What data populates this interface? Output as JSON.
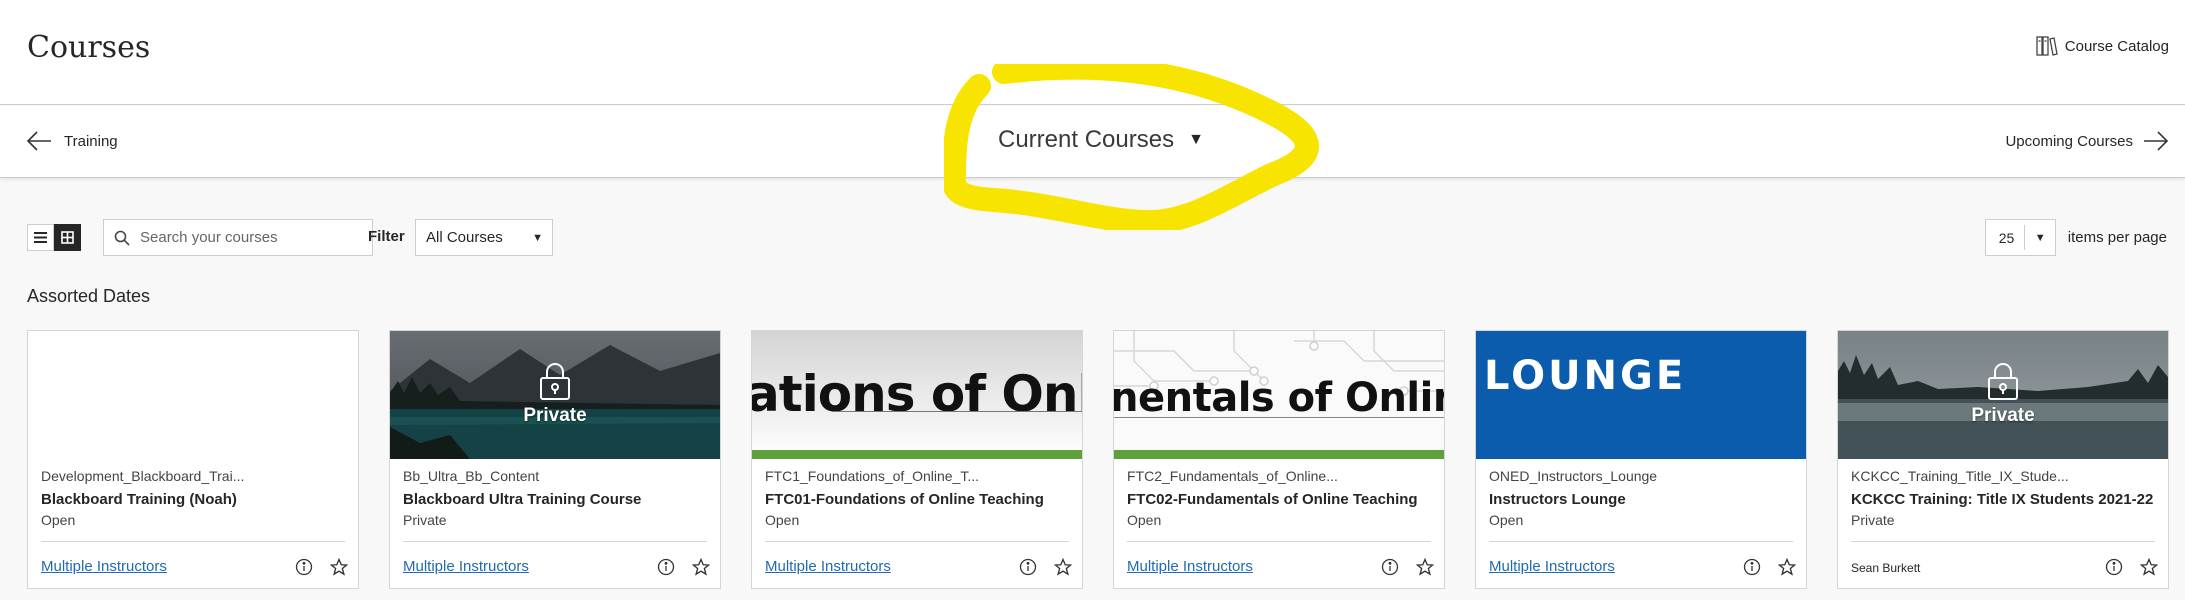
{
  "header": {
    "title": "Courses",
    "catalog_label": "Course Catalog"
  },
  "term_nav": {
    "previous": "Training",
    "current": "Current Courses",
    "next": "Upcoming Courses"
  },
  "toolbar": {
    "search_placeholder": "Search your courses",
    "filter_label": "Filter",
    "filter_value": "All Courses",
    "per_page_value": "25",
    "per_page_label": "items per page"
  },
  "section": {
    "title": "Assorted Dates"
  },
  "courses": [
    {
      "id": "Development_Blackboard_Trai...",
      "name": "Blackboard Training (Noah)",
      "status": "Open",
      "instructor": "Multiple Instructors",
      "banner": "blank"
    },
    {
      "id": "Bb_Ultra_Bb_Content",
      "name": "Blackboard Ultra Training Course",
      "status": "Private",
      "instructor": "Multiple Instructors",
      "banner": "private-lake",
      "overlay_label": "Private"
    },
    {
      "id": "FTC1_Foundations_of_Online_T...",
      "name": "FTC01-Foundations of Online Teaching",
      "status": "Open",
      "instructor": "Multiple Instructors",
      "banner": "foundations",
      "banner_text": "ations of Onlin"
    },
    {
      "id": "FTC2_Fundamentals_of_Online...",
      "name": "FTC02-Fundamentals of Online Teaching",
      "status": "Open",
      "instructor": "Multiple Instructors",
      "banner": "fundamentals",
      "banner_text": "nentals of Online"
    },
    {
      "id": "ONED_Instructors_Lounge",
      "name": "Instructors Lounge",
      "status": "Open",
      "instructor": "Multiple Instructors",
      "banner": "lounge",
      "banner_text": "LOUNGE"
    },
    {
      "id": "KCKCC_Training_Title_IX_Stude...",
      "name": "KCKCC Training: Title IX Students 2021-22",
      "status": "Private",
      "instructor": "Sean Burkett",
      "banner": "private-fog",
      "overlay_label": "Private"
    }
  ],
  "colors": {
    "link": "#1f6ab5",
    "highlight": "#f7e400",
    "lounge_blue": "#0b5cad",
    "accent_green": "#5ea13a"
  }
}
